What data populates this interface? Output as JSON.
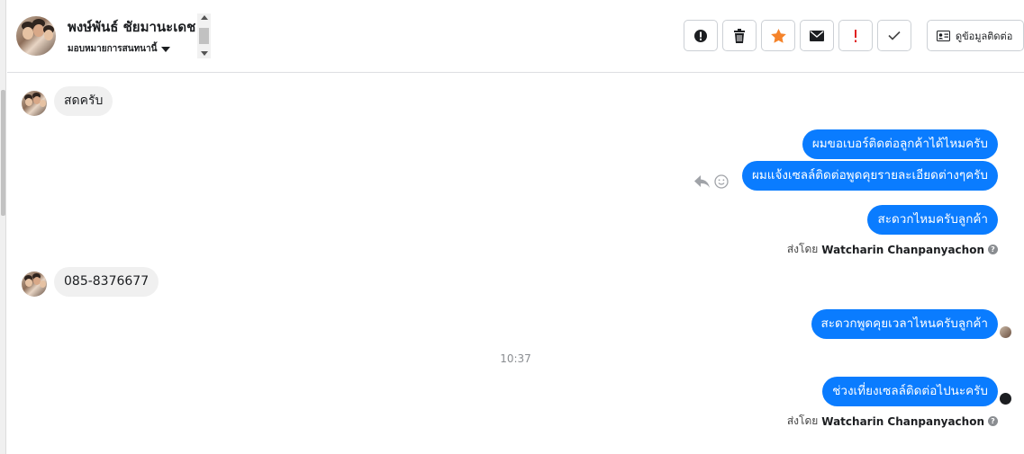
{
  "header": {
    "name": "พงษ์พันธ์ ชัยมานะเดช",
    "subtitle": "มอบหมายการสนทนานี้",
    "contact_button_label": "ดูข้อมูลติดต่อ",
    "toolbar_icons": [
      "alert-circle-icon",
      "trash-icon",
      "star-icon",
      "envelope-icon",
      "exclamation-icon",
      "check-icon"
    ],
    "star_color": "#f5832a",
    "exclamation_color": "#e02020"
  },
  "messages": [
    {
      "from": "customer",
      "text": "สดครับ"
    },
    {
      "from": "page",
      "text": "ผมขอเบอร์ติดต่อลูกค้าได้ไหมครับ"
    },
    {
      "from": "page",
      "text": "ผมแจ้งเซลล์ติดต่อพูดคุยรายละเอียดต่างๆครับ"
    },
    {
      "from": "page",
      "text": "สะดวกไหมครับลูกค้า"
    },
    {
      "from": "customer",
      "text": "085-8376677"
    },
    {
      "from": "page",
      "text": "สะดวกพูดคุยเวลาไหนครับลูกค้า"
    },
    {
      "from": "page",
      "text": "ช่วงเที่ยงเซลล์ติดต่อไปนะครับ"
    }
  ],
  "sent_by": {
    "label": "ส่งโดย",
    "name": "Watcharin Chanpanyachon"
  },
  "time_separator": "10:37",
  "colors": {
    "outgoing_bubble": "#0a7cff",
    "incoming_bubble": "#f0f0f0"
  }
}
